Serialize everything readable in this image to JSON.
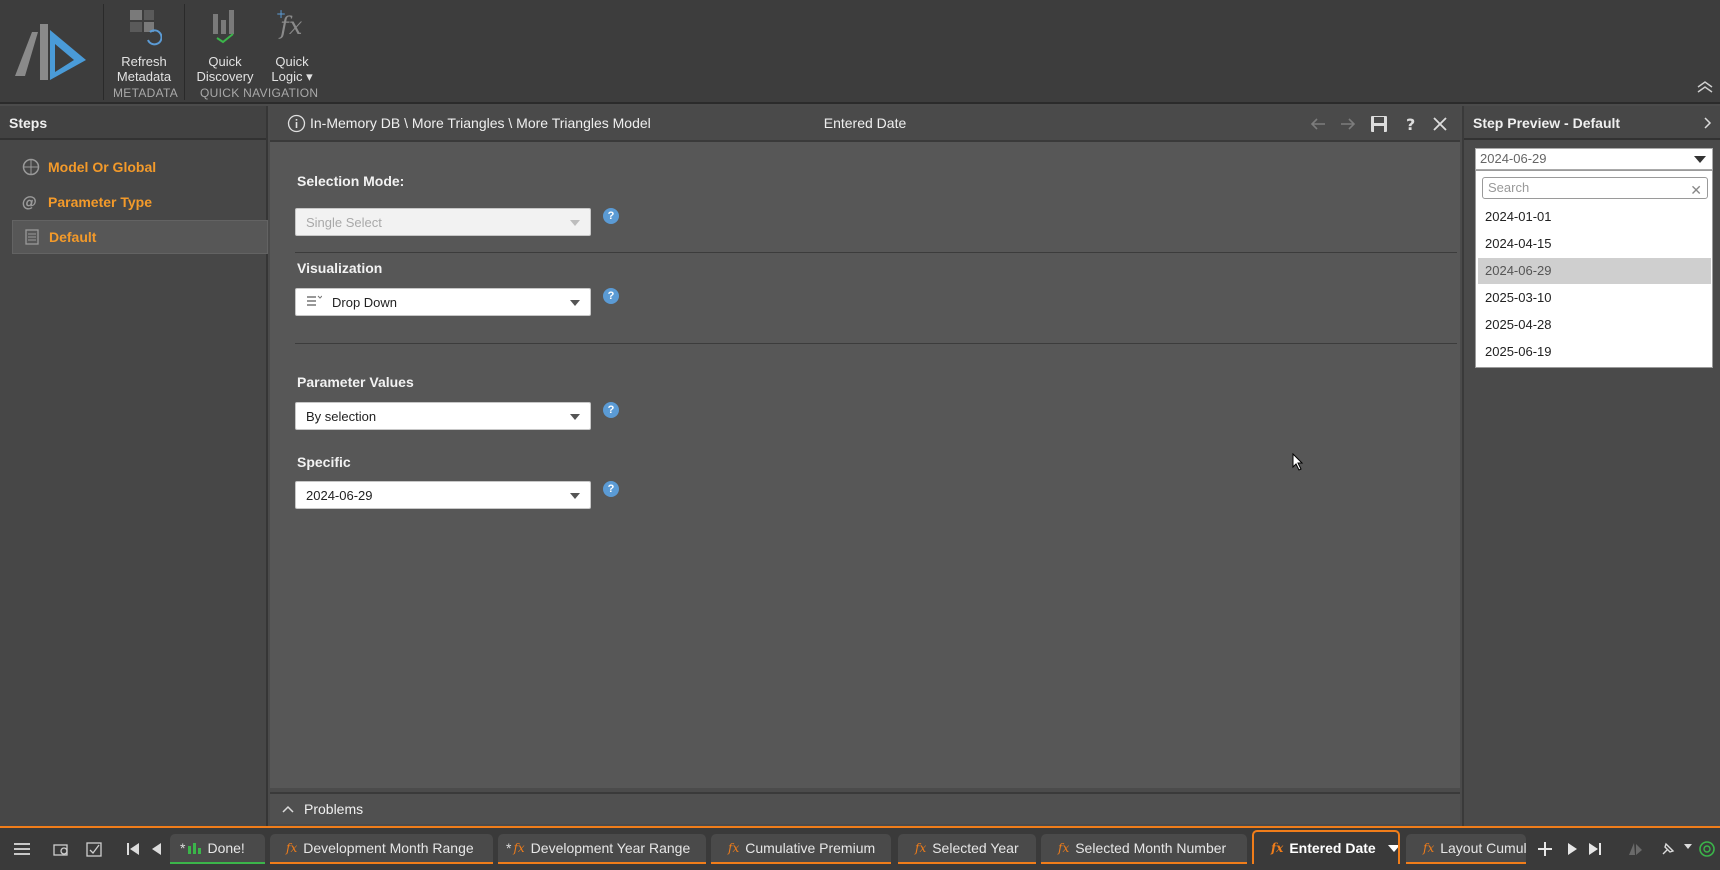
{
  "ribbon": {
    "buttons": [
      {
        "label_line1": "Refresh",
        "label_line2": "Metadata",
        "icon": "refresh-metadata-icon"
      },
      {
        "label_line1": "Quick",
        "label_line2": "Discovery",
        "icon": "quick-discovery-icon"
      },
      {
        "label_line1": "Quick",
        "label_line2": "Logic ▾",
        "icon": "quick-logic-icon"
      }
    ],
    "groups": [
      "METADATA",
      "QUICK NAVIGATION"
    ]
  },
  "steps_panel": {
    "title": "Steps",
    "items": [
      {
        "label": "Model Or Global",
        "icon": "globe-icon"
      },
      {
        "label": "Parameter Type",
        "icon": "at-icon"
      },
      {
        "label": "Default",
        "icon": "calculator-icon",
        "active": true
      }
    ]
  },
  "editor": {
    "breadcrumb": "In-Memory DB \\ More Triangles \\ More Triangles Model",
    "title": "Entered Date",
    "fields": {
      "selection_mode": {
        "label": "Selection Mode:",
        "value": "Single Select"
      },
      "visualization": {
        "label": "Visualization",
        "value": "Drop Down"
      },
      "parameter_values": {
        "label": "Parameter Values",
        "value": "By selection"
      },
      "specific": {
        "label": "Specific",
        "value": "2024-06-29"
      }
    },
    "help_glyph": "?"
  },
  "problems": {
    "label": "Problems"
  },
  "preview": {
    "title": "Step Preview - Default",
    "selected": "2024-06-29",
    "search_placeholder": "Search",
    "options": [
      "2024-01-01",
      "2024-04-15",
      "2024-06-29",
      "2025-03-10",
      "2025-04-28",
      "2025-06-19"
    ],
    "selected_index": 2
  },
  "taskbar": {
    "tabs": [
      {
        "label": "Done!",
        "starred": true,
        "kind": "chart"
      },
      {
        "label": "Development Month Range",
        "starred": false,
        "kind": "fx"
      },
      {
        "label": "Development Year Range",
        "starred": true,
        "kind": "fx"
      },
      {
        "label": "Cumulative Premium",
        "starred": false,
        "kind": "fx"
      },
      {
        "label": "Selected Year",
        "starred": false,
        "kind": "fx"
      },
      {
        "label": "Selected Month Number",
        "starred": false,
        "kind": "fx"
      },
      {
        "label": "Entered Date",
        "starred": false,
        "kind": "fx",
        "active": true
      },
      {
        "label": "Layout Cumula",
        "starred": false,
        "kind": "fx"
      }
    ],
    "fx_glyph": "fx",
    "star_glyph": "*"
  },
  "colors": {
    "accent": "#f07d1a",
    "help": "#5b9bd5",
    "green": "#3bb54a",
    "background": "#4b4b4b"
  }
}
